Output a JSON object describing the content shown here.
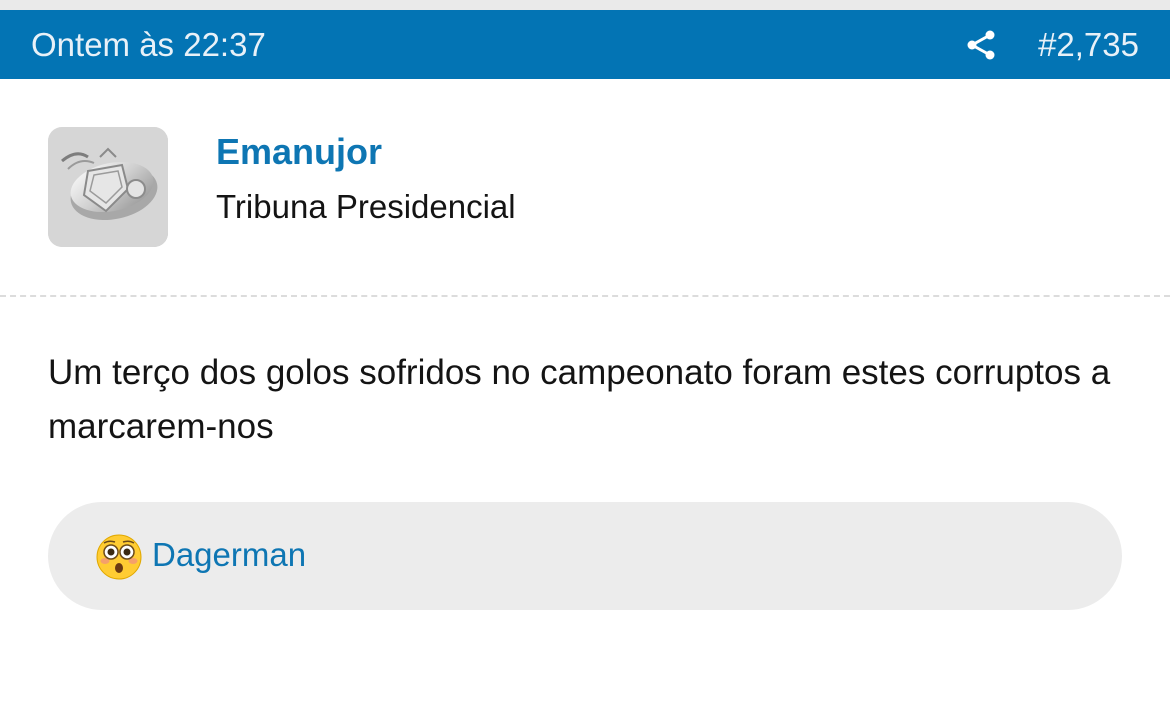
{
  "post": {
    "date": "Ontem às 22:37",
    "number": "#2,735",
    "share_icon": "share-icon"
  },
  "author": {
    "name": "Emanujor",
    "title": "Tribuna Presidencial",
    "avatar_icon": "club-badge-avatar"
  },
  "content": {
    "text": "Um terço dos golos sofridos no campeonato foram estes corruptos a marcarem-nos"
  },
  "reactions": {
    "emoji_icon": "flushed-face-icon",
    "users": "Dagerman"
  },
  "colors": {
    "header_bg": "#0374b4",
    "link": "#0e76b3",
    "reaction_bg": "#ececec"
  }
}
